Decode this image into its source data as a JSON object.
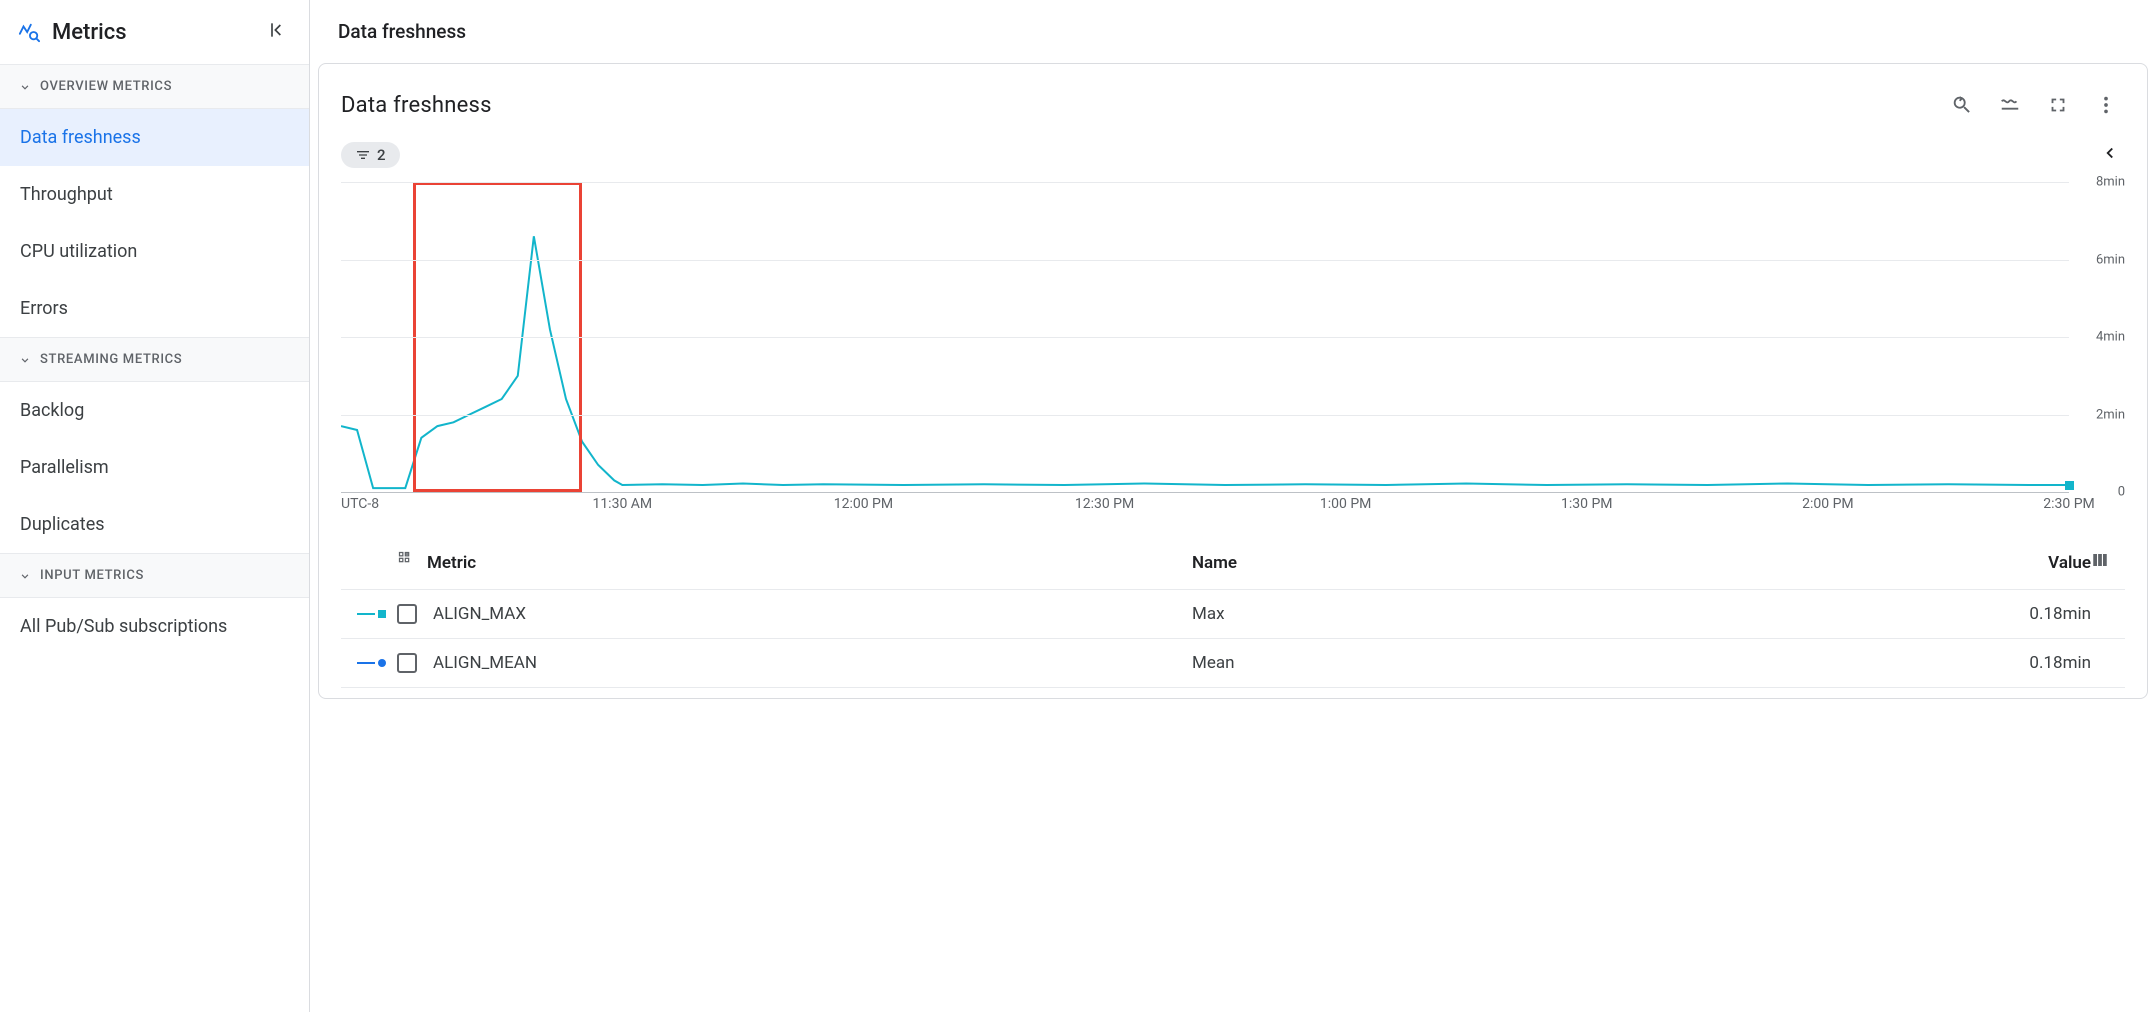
{
  "sidebar": {
    "title": "Metrics",
    "sections": [
      {
        "label": "OVERVIEW METRICS",
        "items": [
          "Data freshness",
          "Throughput",
          "CPU utilization",
          "Errors"
        ],
        "active_index": 0
      },
      {
        "label": "STREAMING METRICS",
        "items": [
          "Backlog",
          "Parallelism",
          "Duplicates"
        ]
      },
      {
        "label": "INPUT METRICS",
        "items": [
          "All Pub/Sub subscriptions"
        ]
      }
    ]
  },
  "page": {
    "title": "Data freshness"
  },
  "card": {
    "title": "Data freshness",
    "filter_count": "2",
    "timezone": "UTC-8",
    "x_ticks": [
      "11:30 AM",
      "12:00 PM",
      "12:30 PM",
      "1:00 PM",
      "1:30 PM",
      "2:00 PM",
      "2:30 PM"
    ],
    "y_ticks": [
      "0",
      "2min",
      "4min",
      "6min",
      "8min"
    ]
  },
  "table": {
    "headers": {
      "metric": "Metric",
      "name": "Name",
      "value": "Value"
    },
    "rows": [
      {
        "metric": "ALIGN_MAX",
        "name": "Max",
        "value": "0.18min",
        "color": "#12b5cb",
        "shape": "square"
      },
      {
        "metric": "ALIGN_MEAN",
        "name": "Mean",
        "value": "0.18min",
        "color": "#1a73e8",
        "shape": "circle"
      }
    ]
  },
  "chart_data": {
    "type": "line",
    "title": "Data freshness",
    "xlabel": "",
    "ylabel": "",
    "ylim": [
      0,
      8
    ],
    "y_unit": "min",
    "series": [
      {
        "name": "Max",
        "color": "#12b5cb",
        "x_minutes_offset": [
          0,
          2,
          4,
          6,
          8,
          10,
          12,
          14,
          16,
          18,
          20,
          22,
          24,
          26,
          28,
          30,
          32,
          34,
          35,
          40,
          45,
          50,
          55,
          60,
          70,
          80,
          90,
          100,
          110,
          120,
          130,
          140,
          150,
          160,
          170,
          180,
          190,
          200,
          210,
          215
        ],
        "values_min": [
          1.7,
          1.6,
          0.1,
          0.1,
          0.1,
          1.4,
          1.7,
          1.8,
          2.0,
          2.2,
          2.4,
          3.0,
          6.6,
          4.2,
          2.4,
          1.3,
          0.7,
          0.3,
          0.18,
          0.2,
          0.18,
          0.22,
          0.18,
          0.2,
          0.18,
          0.2,
          0.18,
          0.22,
          0.18,
          0.2,
          0.18,
          0.22,
          0.18,
          0.2,
          0.18,
          0.22,
          0.18,
          0.2,
          0.18,
          0.18
        ]
      }
    ],
    "highlight_window": {
      "start_min": 9,
      "end_min": 30
    },
    "x_range_min": [
      0,
      215
    ]
  }
}
